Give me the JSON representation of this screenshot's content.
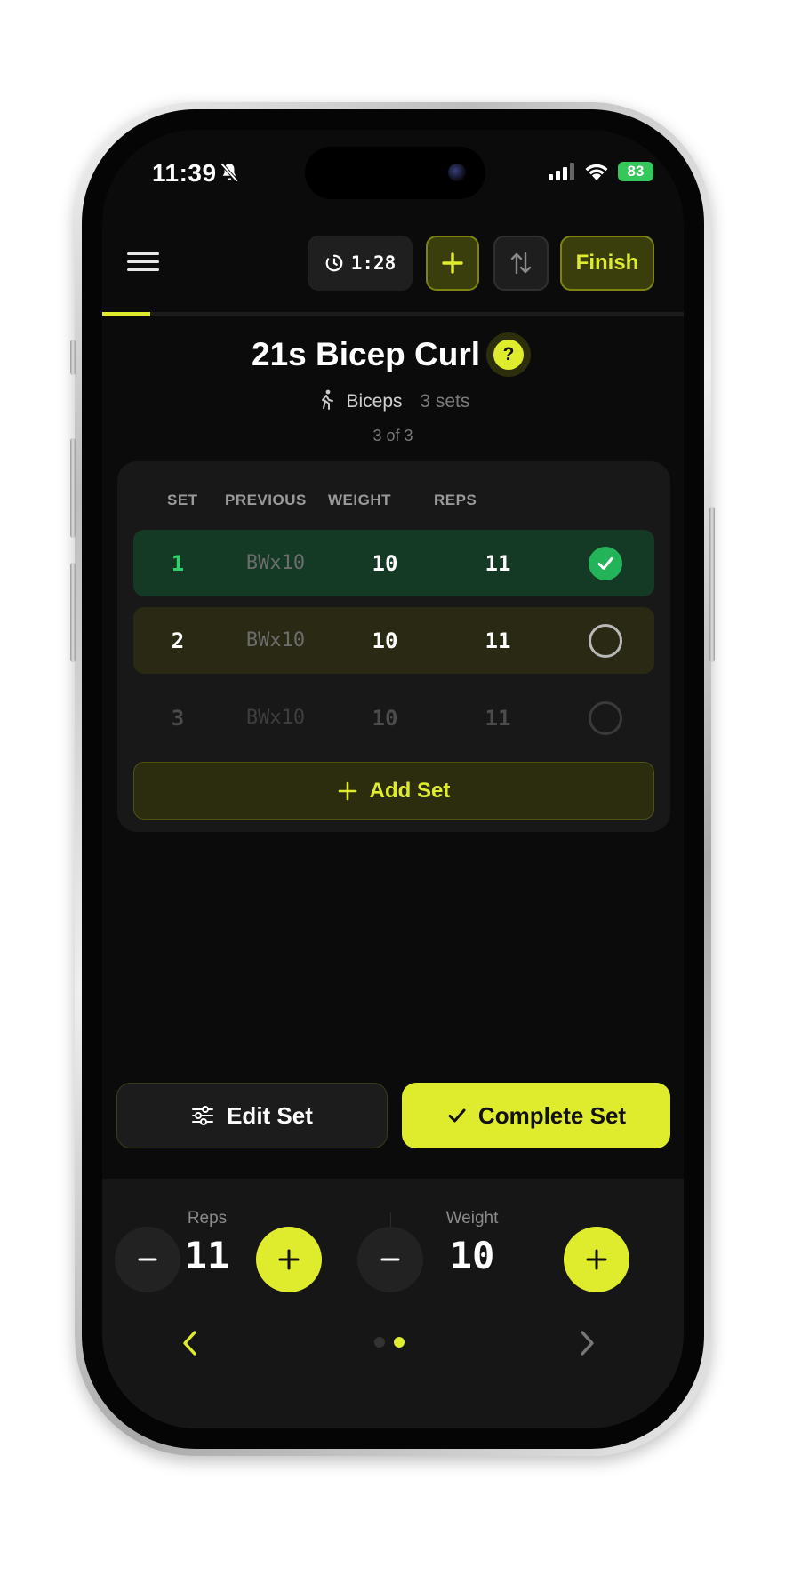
{
  "status_bar": {
    "time": "11:39",
    "battery": "83"
  },
  "header": {
    "timer": "1:28",
    "finish_label": "Finish",
    "progress_fraction": 0.083
  },
  "exercise": {
    "title": "21s Bicep Curl",
    "help_label": "?",
    "muscle": "Biceps",
    "sets_count": "3 sets",
    "position": "3 of 3"
  },
  "table": {
    "headers": {
      "set": "SET",
      "previous": "PREVIOUS",
      "weight": "WEIGHT",
      "reps": "REPS"
    },
    "rows": [
      {
        "set": "1",
        "previous": "BWx10",
        "weight": "10",
        "reps": "11",
        "state": "completed"
      },
      {
        "set": "2",
        "previous": "BWx10",
        "weight": "10",
        "reps": "11",
        "state": "active"
      },
      {
        "set": "3",
        "previous": "BWx10",
        "weight": "10",
        "reps": "11",
        "state": "pending"
      }
    ],
    "add_set_label": "Add Set"
  },
  "actions": {
    "edit_label": "Edit Set",
    "complete_label": "Complete Set"
  },
  "steppers": {
    "reps": {
      "label": "Reps",
      "value": "11"
    },
    "weight": {
      "label": "Weight",
      "value": "10"
    }
  },
  "pager": {
    "current_page": 2,
    "total_pages": 2
  },
  "colors": {
    "accent": "#dfec2e",
    "success": "#23b45a",
    "background": "#0b0b0b",
    "card": "#181818"
  }
}
